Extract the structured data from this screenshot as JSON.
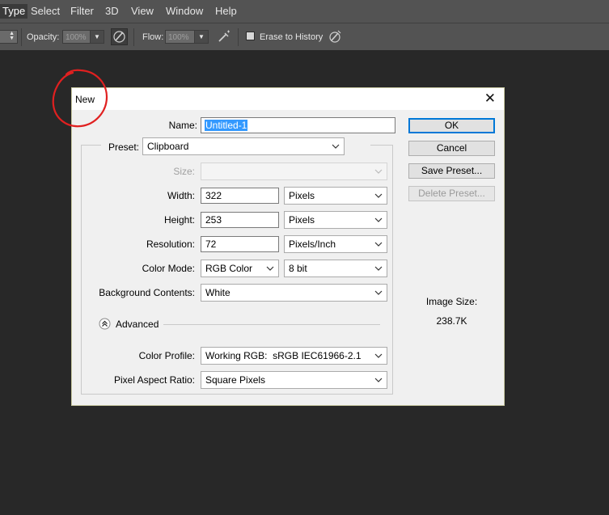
{
  "menubar": {
    "items": [
      "Type",
      "Select",
      "Filter",
      "3D",
      "View",
      "Window",
      "Help"
    ],
    "active": "Type"
  },
  "options": {
    "opacity_label": "Opacity:",
    "opacity_value": "100%",
    "flow_label": "Flow:",
    "flow_value": "100%",
    "erase_history_label": "Erase to History"
  },
  "dialog": {
    "title": "New",
    "name_label": "Name:",
    "name_value": "Untitled-1",
    "preset_label": "Preset:",
    "preset_value": "Clipboard",
    "size_label": "Size:",
    "size_value": "",
    "width_label": "Width:",
    "width_value": "322",
    "width_unit": "Pixels",
    "height_label": "Height:",
    "height_value": "253",
    "height_unit": "Pixels",
    "resolution_label": "Resolution:",
    "resolution_value": "72",
    "resolution_unit": "Pixels/Inch",
    "color_mode_label": "Color Mode:",
    "color_mode_value": "RGB Color",
    "bit_depth_value": "8 bit",
    "background_label": "Background Contents:",
    "background_value": "White",
    "advanced_label": "Advanced",
    "color_profile_label": "Color Profile:",
    "color_profile_value": "Working RGB:  sRGB IEC61966-2.1",
    "pixel_aspect_label": "Pixel Aspect Ratio:",
    "pixel_aspect_value": "Square Pixels",
    "buttons": {
      "ok": "OK",
      "cancel": "Cancel",
      "save_preset": "Save Preset...",
      "delete_preset": "Delete Preset..."
    },
    "image_size_label": "Image Size:",
    "image_size_value": "238.7K"
  },
  "colors": {
    "menubar_bg": "#535353",
    "workspace_bg": "#282828",
    "dialog_bg": "#f0f0f0",
    "selection": "#3399ff",
    "default_button_border": "#0078d7",
    "annotation": "#e02020"
  },
  "icons": [
    "brush-pressure-opacity-icon",
    "airbrush-icon",
    "brush-pressure-size-icon",
    "chevron-down-icon",
    "close-icon",
    "collapse-advanced-icon"
  ]
}
